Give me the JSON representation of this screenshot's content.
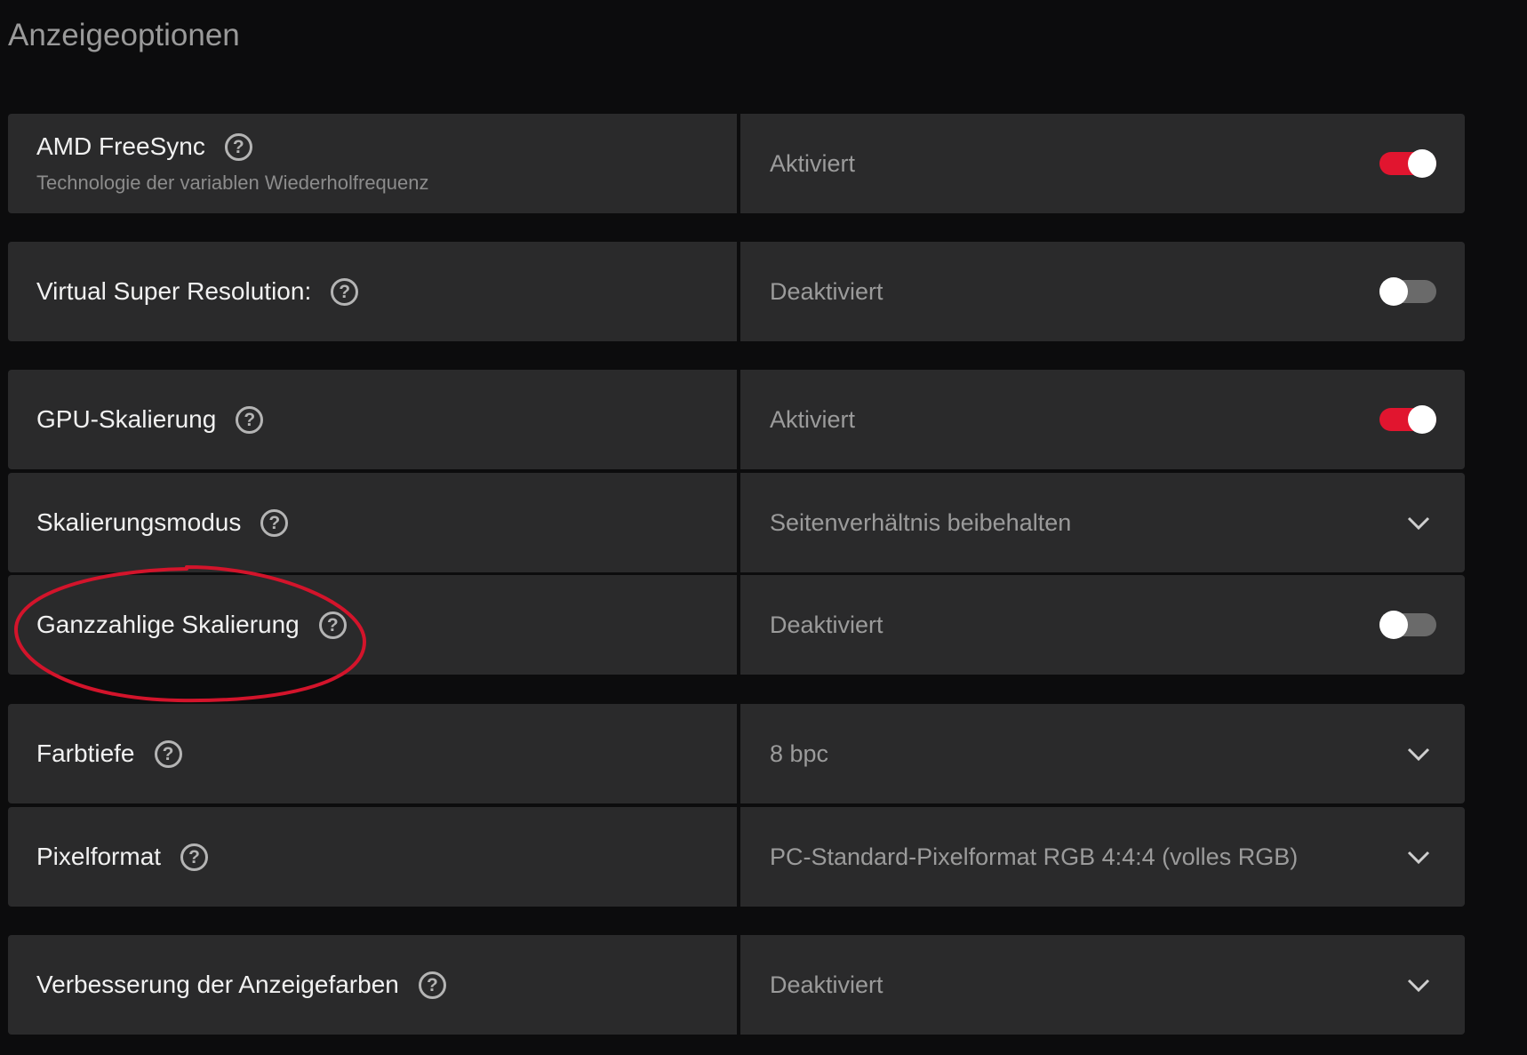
{
  "section_title": "Anzeigeoptionen",
  "settings": [
    {
      "label": "AMD FreeSync",
      "sublabel": "Technologie der variablen Wiederholfrequenz",
      "value": "Aktiviert",
      "control": "toggle",
      "on": true
    },
    {
      "label": "Virtual Super Resolution:",
      "value": "Deaktiviert",
      "control": "toggle",
      "on": false
    },
    {
      "label": "GPU-Skalierung",
      "value": "Aktiviert",
      "control": "toggle",
      "on": true
    },
    {
      "label": "Skalierungsmodus",
      "value": "Seitenverhältnis beibehalten",
      "control": "dropdown"
    },
    {
      "label": "Ganzzahlige Skalierung",
      "value": "Deaktiviert",
      "control": "toggle",
      "on": false
    },
    {
      "label": "Farbtiefe",
      "value": "8 bpc",
      "control": "dropdown"
    },
    {
      "label": "Pixelformat",
      "value": "PC-Standard-Pixelformat RGB 4:4:4 (volles RGB)",
      "control": "dropdown"
    },
    {
      "label": "Verbesserung der Anzeigefarben",
      "value": "Deaktiviert",
      "control": "dropdown"
    }
  ],
  "help_glyph": "?",
  "icons": {
    "help": "question-circle-icon",
    "dropdown": "chevron-down-icon",
    "toggle": "toggle-switch"
  },
  "colors": {
    "background": "#0c0c0d",
    "panel": "#2a2a2b",
    "toggle_on": "#e1152f",
    "toggle_off": "#6a6a6a",
    "annotation": "#d3142b"
  },
  "annotation": {
    "type": "hand-drawn-ellipse",
    "target": "Ganzzahlige Skalierung"
  }
}
